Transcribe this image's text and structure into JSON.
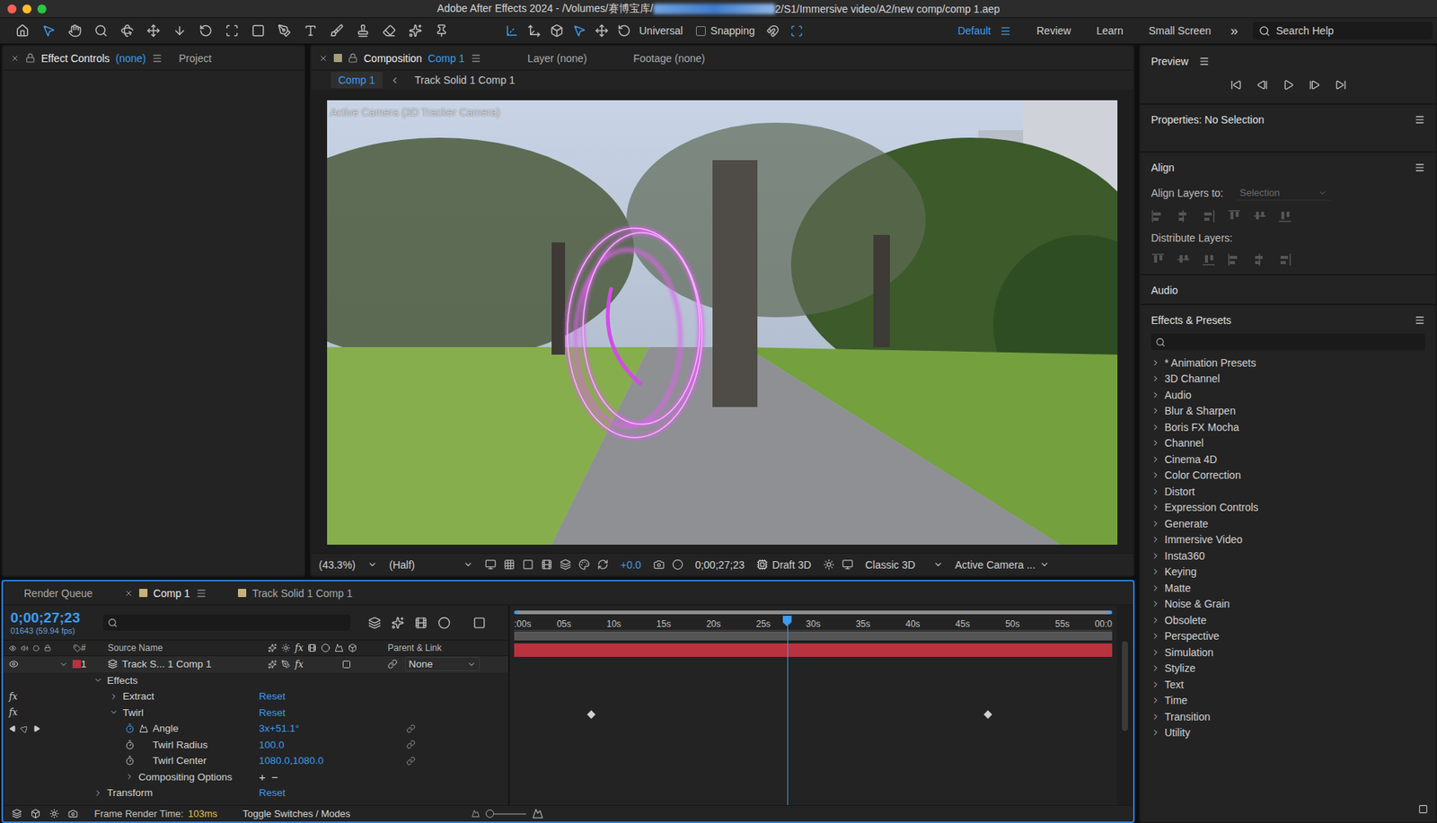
{
  "window": {
    "title_prefix": "Adobe After Effects 2024 - /Volumes/赛博宝库/",
    "title_suffix": "2/S1/Immersive video/A2/new comp/comp 1.aep"
  },
  "toolbar": {
    "tools": [
      {
        "selected": false
      },
      {
        "selected": true
      },
      {
        "selected": false
      },
      {
        "selected": false
      },
      {
        "selected": false
      },
      {
        "selected": false
      },
      {
        "selected": false
      },
      {
        "selected": false
      },
      {
        "selected": false
      },
      {
        "selected": false
      },
      {
        "selected": false
      },
      {
        "selected": false
      },
      {
        "selected": false
      },
      {
        "selected": false
      },
      {
        "selected": false
      },
      {
        "selected": false
      },
      {
        "selected": false
      }
    ],
    "axis_tools": [
      {
        "selected": true
      },
      {
        "selected": false
      },
      {
        "selected": false
      },
      {
        "selected": true
      },
      {
        "selected": false
      },
      {
        "selected": false
      }
    ],
    "rotate_mode": "Universal",
    "snapping": {
      "label": "Snapping",
      "checked": false
    },
    "snap_tools": [
      {
        "selected": false
      },
      {
        "selected": true
      }
    ],
    "workspaces": [
      {
        "label": "Default",
        "selected": true
      },
      {
        "label": "Review",
        "selected": false
      },
      {
        "label": "Learn",
        "selected": false
      },
      {
        "label": "Small Screen",
        "selected": false
      }
    ],
    "overflow": "»",
    "search": {
      "placeholder": "Search Help"
    }
  },
  "left_panel": {
    "tabs": [
      {
        "label": "Effect Controls",
        "suffix": "(none)",
        "selected": true
      },
      {
        "label": "Project",
        "suffix": "",
        "selected": false
      }
    ]
  },
  "composition": {
    "tabs": [
      {
        "label": "Composition",
        "name": "Comp 1",
        "selected": true
      },
      {
        "label": "Layer (none)",
        "name": "",
        "selected": false
      },
      {
        "label": "Footage (none)",
        "name": "",
        "selected": false
      }
    ],
    "breadcrumbs": [
      {
        "label": "Comp 1",
        "selected": true
      },
      {
        "label": "Track Solid 1 Comp 1",
        "selected": false
      }
    ],
    "viewer_label": "Active Camera (3D Tracker Camera)",
    "footer": {
      "zoom": "(43.3%)",
      "resolution": "(Half)",
      "exposure": "+0.0",
      "timecode": "0;00;27;23",
      "renderer_label": "Draft 3D",
      "renderer": "Classic 3D",
      "view": "Active Camera ..."
    }
  },
  "right_panel": {
    "preview": "Preview",
    "properties": "Properties: No Selection",
    "align": {
      "title": "Align",
      "align_to_label": "Align Layers to:",
      "align_to": "Selection",
      "distribute_label": "Distribute Layers:"
    },
    "audio": "Audio",
    "effects": {
      "title": "Effects & Presets",
      "items": [
        "* Animation Presets",
        "3D Channel",
        "Audio",
        "Blur & Sharpen",
        "Boris FX Mocha",
        "Channel",
        "Cinema 4D",
        "Color Correction",
        "Distort",
        "Expression Controls",
        "Generate",
        "Immersive Video",
        "Insta360",
        "Keying",
        "Matte",
        "Noise & Grain",
        "Obsolete",
        "Perspective",
        "Simulation",
        "Stylize",
        "Text",
        "Time",
        "Transition",
        "Utility"
      ]
    }
  },
  "timeline": {
    "tabs": [
      {
        "label": "Render Queue",
        "selected": false,
        "color": ""
      },
      {
        "label": "Comp 1",
        "selected": true,
        "color": "#c9b27a"
      },
      {
        "label": "Track Solid 1 Comp 1",
        "selected": false,
        "color": "#c9b27a"
      }
    ],
    "timecode": "0;00;27;23",
    "frame": "01643 (59.94 fps)",
    "columns": {
      "number": "#",
      "source_name": "Source Name",
      "parent": "Parent & Link"
    },
    "fx": "fx",
    "ruler": [
      ":00s",
      "05s",
      "10s",
      "15s",
      "20s",
      "25s",
      "30s",
      "35s",
      "40s",
      "45s",
      "50s",
      "55s",
      "00:0"
    ],
    "duration": 60,
    "playhead": 27.38,
    "rows": [
      {
        "kind": "layer",
        "number": "1",
        "name": "Track S... 1 Comp 1",
        "parent": "None",
        "expanded": true,
        "label_color": "#b8333d"
      },
      {
        "kind": "group",
        "label": "Effects",
        "depth": 1,
        "expanded": true,
        "value": ""
      },
      {
        "kind": "effect",
        "label": "Extract",
        "depth": 2,
        "expanded": false,
        "value": "Reset"
      },
      {
        "kind": "effect",
        "label": "Twirl",
        "depth": 2,
        "expanded": true,
        "value": "Reset"
      },
      {
        "kind": "property",
        "label": "Angle",
        "depth": 3,
        "value": "3x+51.1°",
        "animated": true,
        "keyframes": [
          7.7,
          47.5
        ]
      },
      {
        "kind": "property",
        "label": "Twirl Radius",
        "depth": 3,
        "value": "100.0",
        "animated": false,
        "keyframes": []
      },
      {
        "kind": "property",
        "label": "Twirl Center",
        "depth": 3,
        "value": "1080.0,1080.0",
        "animated": false,
        "keyframes": []
      },
      {
        "kind": "options",
        "label": "Compositing Options",
        "depth": 3,
        "expanded": false,
        "add": "+",
        "remove": "−"
      },
      {
        "kind": "group",
        "label": "Transform",
        "depth": 1,
        "expanded": false,
        "value": "Reset"
      }
    ],
    "status": {
      "render_label": "Frame Render Time:",
      "render_time": "103ms",
      "toggle": "Toggle Switches / Modes"
    }
  }
}
